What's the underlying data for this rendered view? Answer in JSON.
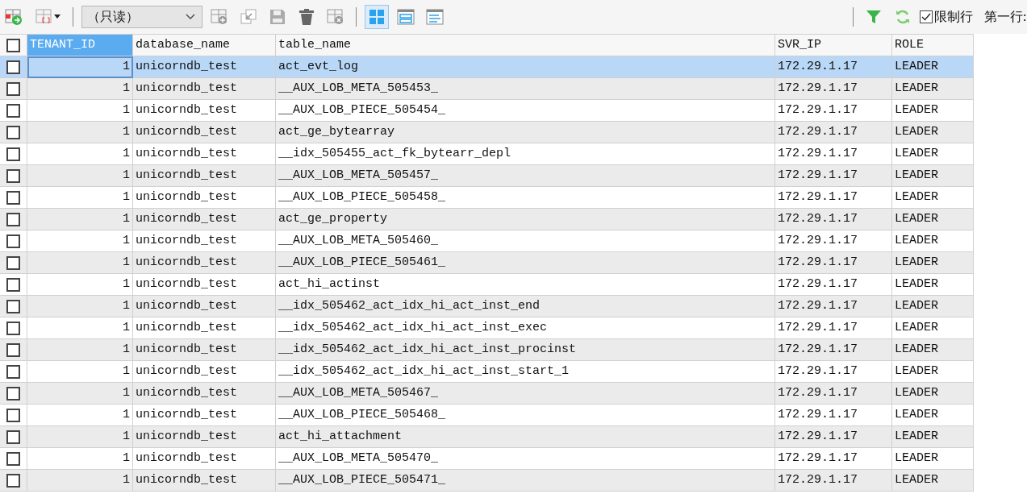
{
  "toolbar": {
    "mode_select": {
      "value": "（只读）"
    },
    "view_buttons": [
      {
        "kind": "grid",
        "selected": true
      },
      {
        "kind": "form",
        "selected": false
      },
      {
        "kind": "text",
        "selected": false
      }
    ],
    "limit_rows": {
      "label": "限制行",
      "checked": true
    },
    "first_row_label": "第一行:"
  },
  "table": {
    "header_checked": false,
    "columns": [
      {
        "label": "TENANT_ID",
        "selected": true,
        "kind": "number"
      },
      {
        "label": "database_name",
        "selected": false,
        "kind": "text"
      },
      {
        "label": "table_name",
        "selected": false,
        "kind": "text"
      },
      {
        "label": "SVR_IP",
        "selected": false,
        "kind": "text"
      },
      {
        "label": "ROLE",
        "selected": false,
        "kind": "text"
      }
    ],
    "rows": [
      {
        "selected": true,
        "checked": false,
        "cells": [
          "1",
          "unicorndb_test",
          "act_evt_log",
          "172.29.1.17",
          "LEADER"
        ]
      },
      {
        "selected": false,
        "checked": false,
        "cells": [
          "1",
          "unicorndb_test",
          "__AUX_LOB_META_505453_",
          "172.29.1.17",
          "LEADER"
        ]
      },
      {
        "selected": false,
        "checked": false,
        "cells": [
          "1",
          "unicorndb_test",
          "__AUX_LOB_PIECE_505454_",
          "172.29.1.17",
          "LEADER"
        ]
      },
      {
        "selected": false,
        "checked": false,
        "cells": [
          "1",
          "unicorndb_test",
          "act_ge_bytearray",
          "172.29.1.17",
          "LEADER"
        ]
      },
      {
        "selected": false,
        "checked": false,
        "cells": [
          "1",
          "unicorndb_test",
          "__idx_505455_act_fk_bytearr_depl",
          "172.29.1.17",
          "LEADER"
        ]
      },
      {
        "selected": false,
        "checked": false,
        "cells": [
          "1",
          "unicorndb_test",
          "__AUX_LOB_META_505457_",
          "172.29.1.17",
          "LEADER"
        ]
      },
      {
        "selected": false,
        "checked": false,
        "cells": [
          "1",
          "unicorndb_test",
          "__AUX_LOB_PIECE_505458_",
          "172.29.1.17",
          "LEADER"
        ]
      },
      {
        "selected": false,
        "checked": false,
        "cells": [
          "1",
          "unicorndb_test",
          "act_ge_property",
          "172.29.1.17",
          "LEADER"
        ]
      },
      {
        "selected": false,
        "checked": false,
        "cells": [
          "1",
          "unicorndb_test",
          "__AUX_LOB_META_505460_",
          "172.29.1.17",
          "LEADER"
        ]
      },
      {
        "selected": false,
        "checked": false,
        "cells": [
          "1",
          "unicorndb_test",
          "__AUX_LOB_PIECE_505461_",
          "172.29.1.17",
          "LEADER"
        ]
      },
      {
        "selected": false,
        "checked": false,
        "cells": [
          "1",
          "unicorndb_test",
          "act_hi_actinst",
          "172.29.1.17",
          "LEADER"
        ]
      },
      {
        "selected": false,
        "checked": false,
        "cells": [
          "1",
          "unicorndb_test",
          "__idx_505462_act_idx_hi_act_inst_end",
          "172.29.1.17",
          "LEADER"
        ]
      },
      {
        "selected": false,
        "checked": false,
        "cells": [
          "1",
          "unicorndb_test",
          "__idx_505462_act_idx_hi_act_inst_exec",
          "172.29.1.17",
          "LEADER"
        ]
      },
      {
        "selected": false,
        "checked": false,
        "cells": [
          "1",
          "unicorndb_test",
          "__idx_505462_act_idx_hi_act_inst_procinst",
          "172.29.1.17",
          "LEADER"
        ]
      },
      {
        "selected": false,
        "checked": false,
        "cells": [
          "1",
          "unicorndb_test",
          "__idx_505462_act_idx_hi_act_inst_start_1",
          "172.29.1.17",
          "LEADER"
        ]
      },
      {
        "selected": false,
        "checked": false,
        "cells": [
          "1",
          "unicorndb_test",
          "__AUX_LOB_META_505467_",
          "172.29.1.17",
          "LEADER"
        ]
      },
      {
        "selected": false,
        "checked": false,
        "cells": [
          "1",
          "unicorndb_test",
          "__AUX_LOB_PIECE_505468_",
          "172.29.1.17",
          "LEADER"
        ]
      },
      {
        "selected": false,
        "checked": false,
        "cells": [
          "1",
          "unicorndb_test",
          "act_hi_attachment",
          "172.29.1.17",
          "LEADER"
        ]
      },
      {
        "selected": false,
        "checked": false,
        "cells": [
          "1",
          "unicorndb_test",
          "__AUX_LOB_META_505470_",
          "172.29.1.17",
          "LEADER"
        ]
      },
      {
        "selected": false,
        "checked": false,
        "cells": [
          "1",
          "unicorndb_test",
          "__AUX_LOB_PIECE_505471_",
          "172.29.1.17",
          "LEADER"
        ]
      }
    ]
  }
}
